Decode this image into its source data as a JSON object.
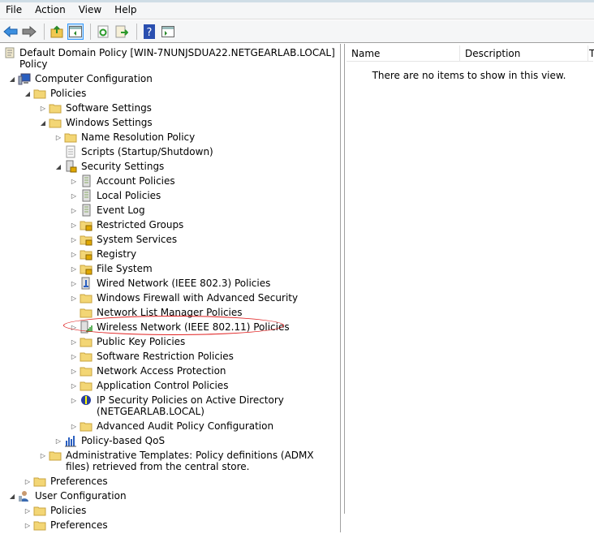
{
  "menu": [
    "File",
    "Action",
    "View",
    "Help"
  ],
  "toolbar": [
    "back-icon",
    "forward-icon",
    "up-folder-icon",
    "show-hide-tree-icon",
    "refresh-icon",
    "export-list-icon",
    "help-icon",
    "show-action-pane-icon"
  ],
  "tree": [
    {
      "label": "Default Domain Policy [WIN-7NUNJSDUA22.NETGEARLAB.LOCAL] Policy",
      "level": 0,
      "exp": "none",
      "icon": "policy-scroll"
    },
    {
      "label": "Computer Configuration",
      "level": 1,
      "exp": "open",
      "icon": "computer"
    },
    {
      "label": "Policies",
      "level": 2,
      "exp": "open",
      "icon": "folder"
    },
    {
      "label": "Software Settings",
      "level": 3,
      "exp": "closed",
      "icon": "folder"
    },
    {
      "label": "Windows Settings",
      "level": 3,
      "exp": "open",
      "icon": "folder"
    },
    {
      "label": "Name Resolution Policy",
      "level": 4,
      "exp": "closed",
      "icon": "folder"
    },
    {
      "label": "Scripts (Startup/Shutdown)",
      "level": 4,
      "exp": "none",
      "icon": "script"
    },
    {
      "label": "Security Settings",
      "level": 4,
      "exp": "open",
      "icon": "security"
    },
    {
      "label": "Account Policies",
      "level": 5,
      "exp": "closed",
      "icon": "server"
    },
    {
      "label": "Local Policies",
      "level": 5,
      "exp": "closed",
      "icon": "server"
    },
    {
      "label": "Event Log",
      "level": 5,
      "exp": "closed",
      "icon": "server"
    },
    {
      "label": "Restricted Groups",
      "level": 5,
      "exp": "closed",
      "icon": "lock-folder"
    },
    {
      "label": "System Services",
      "level": 5,
      "exp": "closed",
      "icon": "lock-folder"
    },
    {
      "label": "Registry",
      "level": 5,
      "exp": "closed",
      "icon": "lock-folder"
    },
    {
      "label": "File System",
      "level": 5,
      "exp": "closed",
      "icon": "lock-folder"
    },
    {
      "label": "Wired Network (IEEE 802.3) Policies",
      "level": 5,
      "exp": "closed",
      "icon": "network"
    },
    {
      "label": "Windows Firewall with Advanced Security",
      "level": 5,
      "exp": "closed",
      "icon": "folder"
    },
    {
      "label": "Network List Manager Policies",
      "level": 5,
      "exp": "none",
      "icon": "folder"
    },
    {
      "label": "Wireless Network (IEEE 802.11) Policies",
      "level": 5,
      "exp": "closed",
      "icon": "wireless"
    },
    {
      "label": "Public Key Policies",
      "level": 5,
      "exp": "closed",
      "icon": "folder"
    },
    {
      "label": "Software Restriction Policies",
      "level": 5,
      "exp": "closed",
      "icon": "folder"
    },
    {
      "label": "Network Access Protection",
      "level": 5,
      "exp": "closed",
      "icon": "folder"
    },
    {
      "label": "Application Control Policies",
      "level": 5,
      "exp": "closed",
      "icon": "folder"
    },
    {
      "label": "IP Security Policies on Active Directory (NETGEARLAB.LOCAL)",
      "level": 5,
      "exp": "closed",
      "icon": "ipsec"
    },
    {
      "label": "Advanced Audit Policy Configuration",
      "level": 5,
      "exp": "closed",
      "icon": "folder"
    },
    {
      "label": "Policy-based QoS",
      "level": 4,
      "exp": "closed",
      "icon": "chart"
    },
    {
      "label": "Administrative Templates: Policy definitions (ADMX files) retrieved from the central store.",
      "level": 3,
      "exp": "closed",
      "icon": "folder"
    },
    {
      "label": "Preferences",
      "level": 2,
      "exp": "closed",
      "icon": "folder"
    },
    {
      "label": "User Configuration",
      "level": 1,
      "exp": "open",
      "icon": "user"
    },
    {
      "label": "Policies",
      "level": 2,
      "exp": "closed",
      "icon": "folder"
    },
    {
      "label": "Preferences",
      "level": 2,
      "exp": "closed",
      "icon": "folder"
    }
  ],
  "list": {
    "columns": [
      "Name",
      "Description",
      "T"
    ],
    "empty_text": "There are no items to show in this view."
  },
  "highlight_color": "#e02020"
}
